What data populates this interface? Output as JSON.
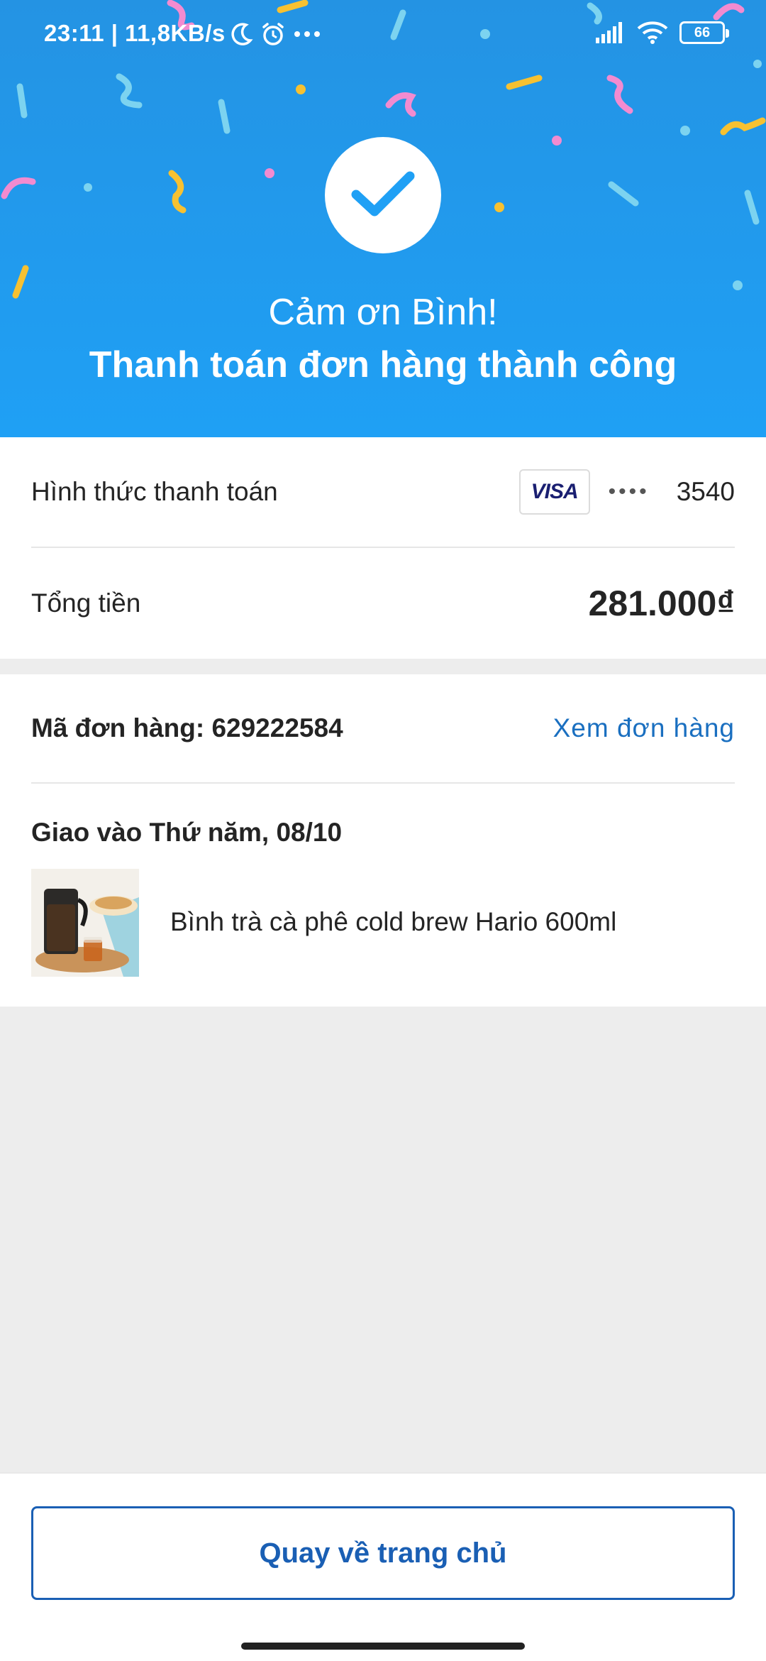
{
  "status_bar": {
    "time": "23:11 | 11,8KB/s",
    "battery": "66",
    "icons": [
      "moon-icon",
      "alarm-icon",
      "more-icon",
      "signal-icon",
      "wifi-icon",
      "battery-icon"
    ]
  },
  "hero": {
    "title": "Cảm ơn Bình!",
    "subtitle": "Thanh toán đơn hàng thành công",
    "icon": "check-icon"
  },
  "payment": {
    "method_label": "Hình thức thanh toán",
    "card_brand": "VISA",
    "card_mask": "••••",
    "card_last4": "3540",
    "total_label": "Tổng tiền",
    "total_value": "281.000₫"
  },
  "order": {
    "code_label": "Mã đơn hàng: 629222584",
    "view_link": "Xem đơn hàng",
    "delivery": "Giao vào Thứ năm, 08/10",
    "product_name": "Bình trà cà phê cold brew Hario 600ml"
  },
  "footer": {
    "home_button": "Quay về trang chủ"
  },
  "colors": {
    "hero_blue": "#1fa0f5",
    "link_blue": "#1a6fc0",
    "button_blue": "#1a5fb4"
  }
}
